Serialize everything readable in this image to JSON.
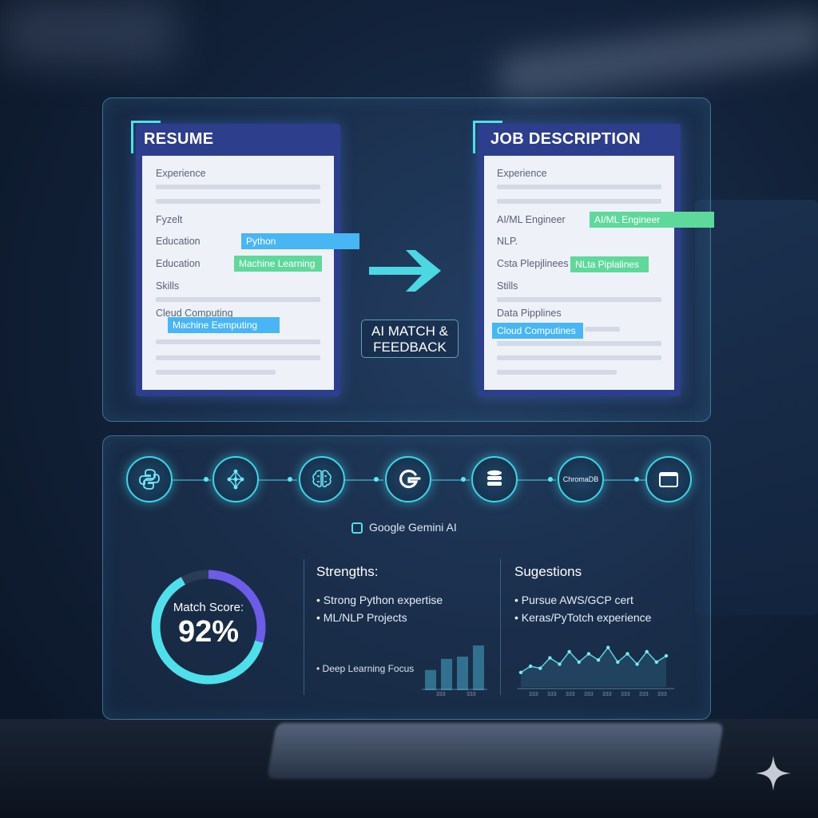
{
  "resume": {
    "title": "RESUME",
    "labels": [
      "Experience",
      "Fyzelt",
      "Education",
      "Education",
      "Skills",
      "Cleud Computing"
    ],
    "tags": [
      "Python",
      "Machine Learning",
      "Machine Eemputing"
    ]
  },
  "job": {
    "title": "JOB DESCRIPTION",
    "labels": [
      "Experience",
      "AI/ML Engineer",
      "NLP.",
      "Csta Plepjlinees",
      "Stills",
      "Data Pipplines"
    ],
    "tags": [
      "AI/ML Engineer",
      "NLta Piplalines",
      "Cloud Computines"
    ]
  },
  "match_label": "AI MATCH & FEEDBACK",
  "pipeline": {
    "nodes": [
      {
        "icon": "python-icon"
      },
      {
        "icon": "network-icon"
      },
      {
        "icon": "brain-icon"
      },
      {
        "icon": "gemini-g-icon"
      },
      {
        "icon": "database-icon"
      },
      {
        "icon": "chromadb-icon",
        "label": "ChromaDB"
      },
      {
        "icon": "browser-window-icon"
      }
    ],
    "gemini_label": "Google Gemini AI"
  },
  "score": {
    "label": "Match Score:",
    "value": "92%",
    "percent": 92,
    "colors": [
      "#4ee0ea",
      "#6c5ce7"
    ]
  },
  "strengths": {
    "title": "Strengths:",
    "items": [
      "• Strong Python expertise",
      "• ML/NLP Projects"
    ],
    "extra": "• Deep Learning Focus",
    "bars": [
      0.45,
      0.7,
      0.75,
      1.0
    ],
    "ticks": [
      "333",
      "333"
    ]
  },
  "suggestions": {
    "title": "Sugestions",
    "items": [
      "• Pursue AWS/GCP cert",
      "• Keras/PyTotch experience"
    ],
    "line": [
      0.35,
      0.5,
      0.45,
      0.7,
      0.55,
      0.85,
      0.6,
      0.8,
      0.65,
      0.95,
      0.6,
      0.8,
      0.55,
      0.85,
      0.6,
      0.75
    ],
    "ticks": [
      "333",
      "333",
      "333",
      "333",
      "333",
      "333",
      "333",
      "333"
    ]
  }
}
